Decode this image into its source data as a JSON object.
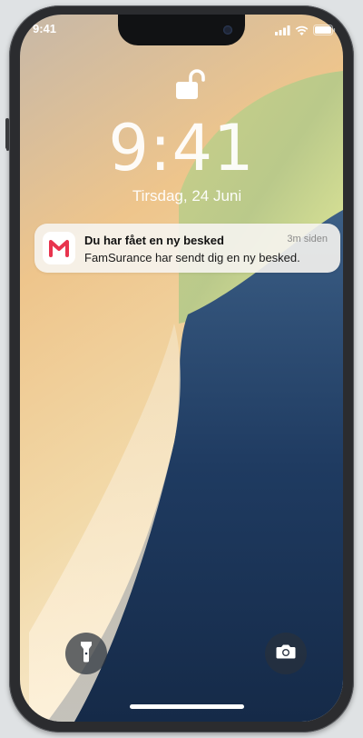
{
  "status_bar": {
    "time": "9:41",
    "icons": [
      "signal-icon",
      "wifi-icon",
      "battery-icon"
    ]
  },
  "lock_screen": {
    "lock_state": "unlocked-padlock-icon",
    "clock": "9:41",
    "date": "Tirsdag, 24 Juni"
  },
  "notification": {
    "app_icon": "m-logo-icon",
    "title": "Du har fået en ny besked",
    "time_ago": "3m siden",
    "body": "FamSurance har sendt dig en ny besked.",
    "accent_color": "#e8344e"
  },
  "quick_actions": {
    "left": "flashlight-icon",
    "right": "camera-icon"
  }
}
